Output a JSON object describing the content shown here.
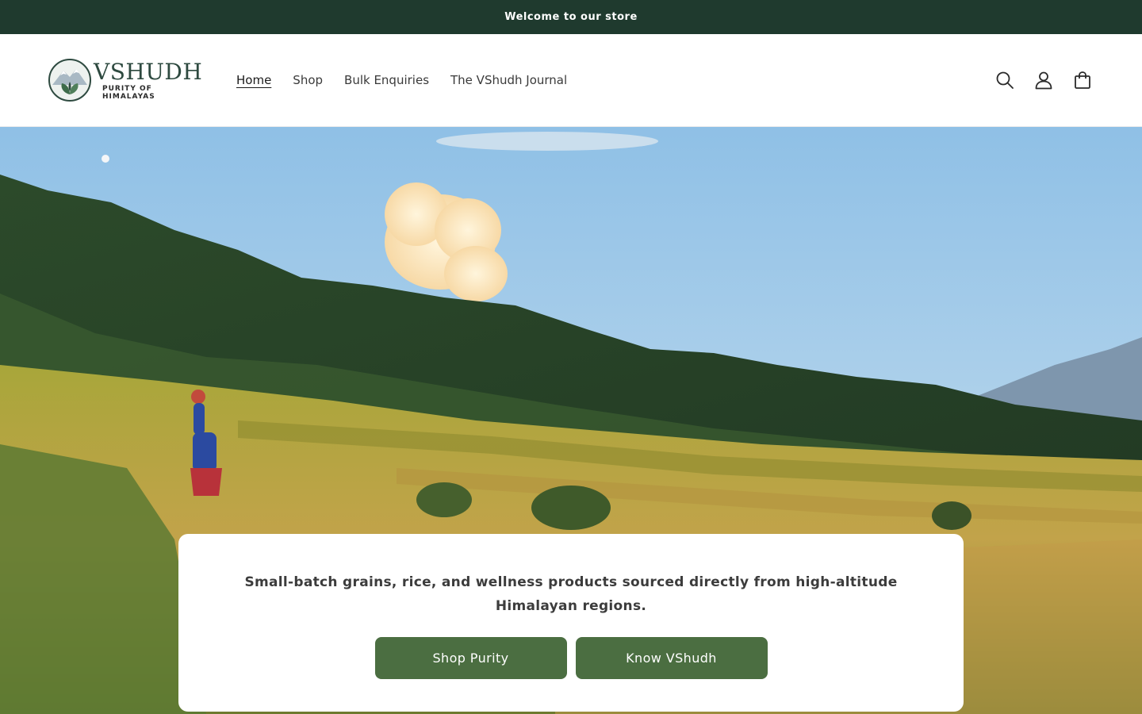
{
  "announcement": {
    "text": "Welcome to our store"
  },
  "brand": {
    "name": "VSHUDH",
    "tagline": "PURITY OF HIMALAYAS"
  },
  "nav": {
    "items": [
      {
        "label": "Home",
        "active": true
      },
      {
        "label": "Shop",
        "active": false
      },
      {
        "label": "Bulk Enquiries",
        "active": false
      },
      {
        "label": "The VShudh Journal",
        "active": false
      }
    ]
  },
  "header_icons": [
    "search-icon",
    "account-icon",
    "cart-icon"
  ],
  "hero": {
    "text": "Small-batch grains, rice, and wellness products sourced directly from high-altitude Himalayan regions.",
    "buttons": [
      {
        "label": "Shop Purity"
      },
      {
        "label": "Know VShudh"
      }
    ]
  },
  "colors": {
    "announcement_bg": "#1f3a2e",
    "button_bg": "#4b6e41",
    "brand_text": "#2e4a40"
  }
}
